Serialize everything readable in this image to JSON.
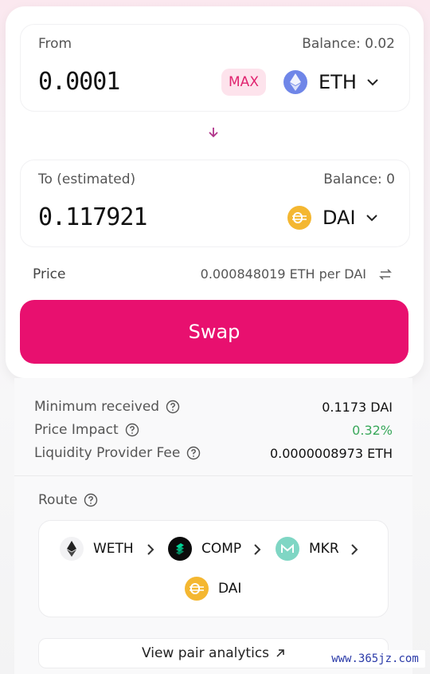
{
  "from": {
    "label": "From",
    "balance": "Balance: 0.02",
    "amount": "0.0001",
    "max_label": "MAX",
    "token": "ETH",
    "token_icon": "eth-icon"
  },
  "to": {
    "label": "To (estimated)",
    "balance": "Balance: 0",
    "amount": "0.117921",
    "token": "DAI",
    "token_icon": "dai-icon"
  },
  "price": {
    "label": "Price",
    "value": "0.000848019 ETH per DAI"
  },
  "swap_button": "Swap",
  "details": {
    "minimum_received": {
      "label": "Minimum received",
      "value": "0.1173 DAI"
    },
    "price_impact": {
      "label": "Price Impact",
      "value": "0.32%"
    },
    "lp_fee": {
      "label": "Liquidity Provider Fee",
      "value": "0.0000008973 ETH"
    }
  },
  "route": {
    "label": "Route",
    "tokens": [
      "WETH",
      "COMP",
      "MKR",
      "DAI"
    ]
  },
  "analytics_button": "View pair analytics",
  "watermark": "www.365jz.com",
  "colors": {
    "accent": "#e8106f",
    "max_bg": "#fde3ec",
    "positive": "#3aa85b",
    "eth": "#6f86e8",
    "dai": "#f4b731"
  }
}
